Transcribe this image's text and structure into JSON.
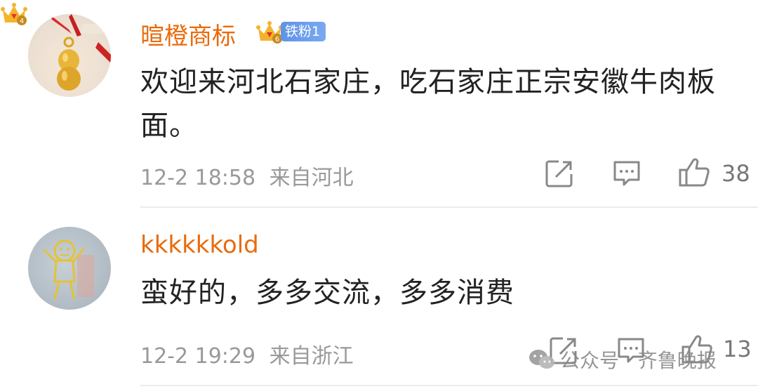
{
  "comments": [
    {
      "username": "暄橙商标",
      "fan_badge": "铁粉1",
      "crown_level": "6",
      "content": "欢迎来河北石家庄，吃石家庄正宗安徽牛肉板面。",
      "time": "12-2 18:58",
      "location": "来自河北",
      "likes": "38"
    },
    {
      "username": "kkkkkkold",
      "crown_level": "4",
      "content": "蛮好的，多多交流，多多消费",
      "time": "12-2 19:29",
      "location": "来自浙江",
      "likes": "13"
    }
  ],
  "watermark": {
    "text": "公众号 · 齐鲁晚报"
  },
  "colors": {
    "username": "#e86b0c",
    "text": "#222222",
    "meta": "#999999",
    "badge": "#6a9ded"
  }
}
